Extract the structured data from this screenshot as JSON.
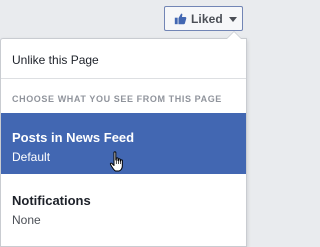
{
  "liked_button": {
    "label": "Liked"
  },
  "menu": {
    "unlike_label": "Unlike this Page",
    "section_header": "CHOOSE WHAT YOU SEE FROM THIS PAGE",
    "options": [
      {
        "title": "Posts in News Feed",
        "value": "Default",
        "highlighted": true
      },
      {
        "title": "Notifications",
        "value": "None",
        "highlighted": false
      }
    ]
  },
  "colors": {
    "highlight": "#4267b2",
    "button_border": "#7285b5",
    "background": "#e9ebee"
  },
  "icons": [
    "thumbs-up-icon",
    "chevron-down-icon",
    "hand-pointer-cursor-icon"
  ]
}
